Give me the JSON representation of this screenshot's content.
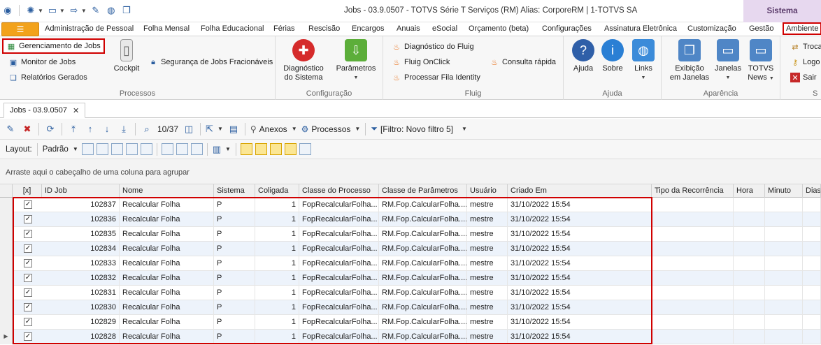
{
  "window": {
    "title": "Jobs - 03.9.0507 - TOTVS Série T Serviços (RM) Alias: CorporeRM | 1-TOTVS SA",
    "sistema_tab": "Sistema"
  },
  "ribbon_tabs": [
    "Administração de Pessoal",
    "Folha Mensal",
    "Folha Educacional",
    "Férias",
    "Rescisão",
    "Encargos",
    "Anuais",
    "eSocial",
    "Orçamento (beta)",
    "Configurações",
    "Assinatura Eletrônica",
    "Customização",
    "Gestão",
    "Ambiente"
  ],
  "ribbon": {
    "processos": {
      "label": "Processos",
      "items": [
        "Gerenciamento de Jobs",
        "Monitor de Jobs",
        "Relatórios Gerados"
      ],
      "cockpit": "Cockpit",
      "seguranca": "Segurança de Jobs Fracionáveis"
    },
    "configuracao": {
      "label": "Configuração",
      "diagnostico": [
        "Diagnóstico",
        "do Sistema"
      ],
      "parametros": "Parâmetros"
    },
    "fluig": {
      "label": "Fluig",
      "items": [
        "Diagnóstico do Fluig",
        "Fluig OnClick",
        "Processar Fila Identity"
      ],
      "consulta": "Consulta rápida"
    },
    "ajuda": {
      "label": "Ajuda",
      "ajuda": "Ajuda",
      "sobre": "Sobre",
      "links": "Links"
    },
    "aparencia": {
      "label": "Aparência",
      "exibicao": [
        "Exibição",
        "em Janelas"
      ],
      "janelas": "Janelas",
      "news": [
        "TOTVS",
        "News"
      ]
    },
    "sistema": {
      "label": "S",
      "items": [
        "Troca",
        "Logo",
        "Sair"
      ]
    }
  },
  "doc_tab": {
    "label": "Jobs - 03.9.0507",
    "close": "✕"
  },
  "toolbar": {
    "counter": "10/37",
    "anexos": "Anexos",
    "processos": "Processos",
    "filtro": "[Filtro: Novo filtro 5]",
    "layout_label": "Layout:",
    "layout_value": "Padrão"
  },
  "group_panel": "Arraste aqui o cabeçalho de uma coluna para agrupar",
  "grid": {
    "columns": [
      "[x]",
      "ID Job",
      "Nome",
      "Sistema",
      "Coligada",
      "Classe do Processo",
      "Classe de Parâmetros",
      "Usuário",
      "Criado Em",
      "Tipo da Recorrência",
      "Hora",
      "Minuto",
      "Dias"
    ],
    "rows": [
      {
        "id": "102837",
        "nome": "Recalcular Folha",
        "sistema": "P",
        "coligada": "1",
        "classe": "FopRecalcularFolha...",
        "param": "RM.Fop.CalcularFolha....",
        "usuario": "mestre",
        "criado": "31/10/2022 15:54"
      },
      {
        "id": "102836",
        "nome": "Recalcular Folha",
        "sistema": "P",
        "coligada": "1",
        "classe": "FopRecalcularFolha...",
        "param": "RM.Fop.CalcularFolha....",
        "usuario": "mestre",
        "criado": "31/10/2022 15:54"
      },
      {
        "id": "102835",
        "nome": "Recalcular Folha",
        "sistema": "P",
        "coligada": "1",
        "classe": "FopRecalcularFolha...",
        "param": "RM.Fop.CalcularFolha....",
        "usuario": "mestre",
        "criado": "31/10/2022 15:54"
      },
      {
        "id": "102834",
        "nome": "Recalcular Folha",
        "sistema": "P",
        "coligada": "1",
        "classe": "FopRecalcularFolha...",
        "param": "RM.Fop.CalcularFolha....",
        "usuario": "mestre",
        "criado": "31/10/2022 15:54"
      },
      {
        "id": "102833",
        "nome": "Recalcular Folha",
        "sistema": "P",
        "coligada": "1",
        "classe": "FopRecalcularFolha...",
        "param": "RM.Fop.CalcularFolha....",
        "usuario": "mestre",
        "criado": "31/10/2022 15:54"
      },
      {
        "id": "102832",
        "nome": "Recalcular Folha",
        "sistema": "P",
        "coligada": "1",
        "classe": "FopRecalcularFolha...",
        "param": "RM.Fop.CalcularFolha....",
        "usuario": "mestre",
        "criado": "31/10/2022 15:54"
      },
      {
        "id": "102831",
        "nome": "Recalcular Folha",
        "sistema": "P",
        "coligada": "1",
        "classe": "FopRecalcularFolha...",
        "param": "RM.Fop.CalcularFolha....",
        "usuario": "mestre",
        "criado": "31/10/2022 15:54"
      },
      {
        "id": "102830",
        "nome": "Recalcular Folha",
        "sistema": "P",
        "coligada": "1",
        "classe": "FopRecalcularFolha...",
        "param": "RM.Fop.CalcularFolha....",
        "usuario": "mestre",
        "criado": "31/10/2022 15:54"
      },
      {
        "id": "102829",
        "nome": "Recalcular Folha",
        "sistema": "P",
        "coligada": "1",
        "classe": "FopRecalcularFolha...",
        "param": "RM.Fop.CalcularFolha....",
        "usuario": "mestre",
        "criado": "31/10/2022 15:54"
      },
      {
        "id": "102828",
        "nome": "Recalcular Folha",
        "sistema": "P",
        "coligada": "1",
        "classe": "FopRecalcularFolha...",
        "param": "RM.Fop.CalcularFolha....",
        "usuario": "mestre",
        "criado": "31/10/2022 15:54"
      }
    ]
  },
  "colors": {
    "accent_orange": "#f2a21b",
    "highlight_red": "#d00000",
    "sistema_tab_bg": "#e7d8ef",
    "row_alt": "#edf3fb"
  }
}
